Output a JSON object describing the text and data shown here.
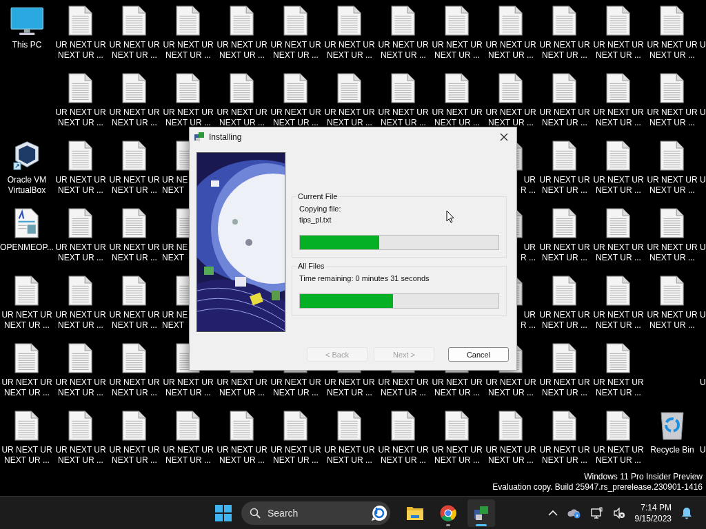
{
  "desktop": {
    "rows": [
      [
        {
          "kind": "computer",
          "label_lines": [
            "This PC"
          ]
        },
        {
          "kind": "text_file",
          "label_lines": [
            "UR NEXT UR",
            "NEXT UR ..."
          ]
        },
        {
          "kind": "text_file",
          "label_lines": [
            "UR NEXT UR",
            "NEXT UR ..."
          ]
        },
        {
          "kind": "text_file",
          "label_lines": [
            "UR NEXT UR",
            "NEXT UR ..."
          ]
        },
        {
          "kind": "text_file",
          "label_lines": [
            "UR NEXT UR",
            "NEXT UR ..."
          ]
        },
        {
          "kind": "text_file",
          "label_lines": [
            "UR NEXT UR",
            "NEXT UR ..."
          ]
        },
        {
          "kind": "text_file",
          "label_lines": [
            "UR NEXT UR",
            "NEXT UR ..."
          ]
        },
        {
          "kind": "text_file",
          "label_lines": [
            "UR NEXT UR",
            "NEXT UR ..."
          ]
        },
        {
          "kind": "text_file",
          "label_lines": [
            "UR NEXT UR",
            "NEXT UR ..."
          ]
        },
        {
          "kind": "text_file",
          "label_lines": [
            "UR NEXT UR",
            "NEXT UR ..."
          ]
        },
        {
          "kind": "text_file",
          "label_lines": [
            "UR NEXT UR",
            "NEXT UR ..."
          ]
        },
        {
          "kind": "text_file",
          "label_lines": [
            "UR NEXT UR",
            "NEXT UR ..."
          ]
        },
        {
          "kind": "text_file",
          "label_lines": [
            "UR NEXT UR",
            "NEXT UR ..."
          ]
        },
        {
          "kind": "label_only",
          "label_lines": [
            "U"
          ],
          "clipped_end": true
        }
      ],
      [
        {
          "kind": "empty"
        },
        {
          "kind": "text_file",
          "label_lines": [
            "UR NEXT UR",
            "NEXT UR ..."
          ]
        },
        {
          "kind": "text_file",
          "label_lines": [
            "UR NEXT UR",
            "NEXT UR ..."
          ]
        },
        {
          "kind": "text_file",
          "label_lines": [
            "UR NEXT UR",
            "NEXT UR ..."
          ]
        },
        {
          "kind": "text_file",
          "label_lines": [
            "UR NEXT UR",
            "NEXT UR ..."
          ]
        },
        {
          "kind": "text_file",
          "label_lines": [
            "UR NEXT UR",
            "NEXT UR ..."
          ]
        },
        {
          "kind": "text_file",
          "label_lines": [
            "UR NEXT UR",
            "NEXT UR ..."
          ]
        },
        {
          "kind": "text_file",
          "label_lines": [
            "UR NEXT UR",
            "NEXT UR ..."
          ]
        },
        {
          "kind": "text_file",
          "label_lines": [
            "UR NEXT UR",
            "NEXT UR ..."
          ]
        },
        {
          "kind": "text_file",
          "label_lines": [
            "UR NEXT UR",
            "NEXT UR ..."
          ]
        },
        {
          "kind": "text_file",
          "label_lines": [
            "UR NEXT UR",
            "NEXT UR ..."
          ]
        },
        {
          "kind": "text_file",
          "label_lines": [
            "UR NEXT UR",
            "NEXT UR ..."
          ]
        },
        {
          "kind": "text_file",
          "label_lines": [
            "UR NEXT UR",
            "NEXT UR ..."
          ]
        },
        {
          "kind": "label_only",
          "label_lines": [
            "U"
          ],
          "clipped_end": true
        }
      ],
      [
        {
          "kind": "virtual_machine",
          "label_lines": [
            "Oracle VM",
            "VirtualBox"
          ]
        },
        {
          "kind": "text_file",
          "label_lines": [
            "UR NEXT UR",
            "NEXT UR ..."
          ]
        },
        {
          "kind": "text_file",
          "label_lines": [
            "UR NEXT UR",
            "NEXT UR ..."
          ]
        },
        {
          "kind": "text_file",
          "label_lines": [
            "UR NE",
            "NEXT"
          ],
          "clipped_end": true
        },
        {
          "kind": "empty"
        },
        {
          "kind": "empty"
        },
        {
          "kind": "empty"
        },
        {
          "kind": "empty"
        },
        {
          "kind": "empty"
        },
        {
          "kind": "text_file",
          "label_lines": [
            "UR",
            "R ..."
          ],
          "clipped_start": true
        },
        {
          "kind": "text_file",
          "label_lines": [
            "UR NEXT UR",
            "NEXT UR ..."
          ]
        },
        {
          "kind": "text_file",
          "label_lines": [
            "UR NEXT UR",
            "NEXT UR ..."
          ]
        },
        {
          "kind": "text_file",
          "label_lines": [
            "UR NEXT UR",
            "NEXT UR ..."
          ]
        },
        {
          "kind": "label_only",
          "label_lines": [
            "U"
          ],
          "clipped_end": true
        }
      ],
      [
        {
          "kind": "document",
          "label_lines": [
            "OPENMEOP..."
          ]
        },
        {
          "kind": "text_file",
          "label_lines": [
            "UR NEXT UR",
            "NEXT UR ..."
          ]
        },
        {
          "kind": "text_file",
          "label_lines": [
            "UR NEXT UR",
            "NEXT UR ..."
          ]
        },
        {
          "kind": "text_file",
          "label_lines": [
            "UR NE",
            "NEXT"
          ],
          "clipped_end": true
        },
        {
          "kind": "empty"
        },
        {
          "kind": "empty"
        },
        {
          "kind": "empty"
        },
        {
          "kind": "empty"
        },
        {
          "kind": "empty"
        },
        {
          "kind": "text_file",
          "label_lines": [
            "UR",
            "R ..."
          ],
          "clipped_start": true
        },
        {
          "kind": "text_file",
          "label_lines": [
            "UR NEXT UR",
            "NEXT UR ..."
          ]
        },
        {
          "kind": "text_file",
          "label_lines": [
            "UR NEXT UR",
            "NEXT UR ..."
          ]
        },
        {
          "kind": "text_file",
          "label_lines": [
            "UR NEXT UR",
            "NEXT UR ..."
          ]
        },
        {
          "kind": "label_only",
          "label_lines": [
            "U"
          ],
          "clipped_end": true
        }
      ],
      [
        {
          "kind": "text_file",
          "label_lines": [
            "UR NEXT UR",
            "NEXT UR ..."
          ]
        },
        {
          "kind": "text_file",
          "label_lines": [
            "UR NEXT UR",
            "NEXT UR ..."
          ]
        },
        {
          "kind": "text_file",
          "label_lines": [
            "UR NEXT UR",
            "NEXT UR ..."
          ]
        },
        {
          "kind": "text_file",
          "label_lines": [
            "UR NE",
            "NEXT"
          ],
          "clipped_end": true
        },
        {
          "kind": "empty"
        },
        {
          "kind": "empty"
        },
        {
          "kind": "empty"
        },
        {
          "kind": "empty"
        },
        {
          "kind": "empty"
        },
        {
          "kind": "text_file",
          "label_lines": [
            "UR",
            "R ..."
          ],
          "clipped_start": true
        },
        {
          "kind": "text_file",
          "label_lines": [
            "UR NEXT UR",
            "NEXT UR ..."
          ]
        },
        {
          "kind": "text_file",
          "label_lines": [
            "UR NEXT UR",
            "NEXT UR ..."
          ]
        },
        {
          "kind": "text_file",
          "label_lines": [
            "UR NEXT UR",
            "NEXT UR ..."
          ]
        },
        {
          "kind": "label_only",
          "label_lines": [
            "U"
          ],
          "clipped_end": true
        }
      ],
      [
        {
          "kind": "text_file",
          "label_lines": [
            "UR NEXT UR",
            "NEXT UR ..."
          ]
        },
        {
          "kind": "text_file",
          "label_lines": [
            "UR NEXT UR",
            "NEXT UR ..."
          ]
        },
        {
          "kind": "text_file",
          "label_lines": [
            "UR NEXT UR",
            "NEXT UR ..."
          ]
        },
        {
          "kind": "text_file",
          "label_lines": [
            "UR NEXT UR",
            "NEXT UR ..."
          ]
        },
        {
          "kind": "text_file",
          "label_lines": [
            "UR NEXT UR",
            "NEXT UR ..."
          ]
        },
        {
          "kind": "text_file",
          "label_lines": [
            "UR NEXT UR",
            "NEXT UR ..."
          ]
        },
        {
          "kind": "text_file",
          "label_lines": [
            "UR NEXT UR",
            "NEXT UR ..."
          ]
        },
        {
          "kind": "text_file",
          "label_lines": [
            "UR NEXT UR",
            "NEXT UR ..."
          ]
        },
        {
          "kind": "text_file",
          "label_lines": [
            "UR NEXT UR",
            "NEXT UR ..."
          ]
        },
        {
          "kind": "text_file",
          "label_lines": [
            "UR NEXT UR",
            "NEXT UR ..."
          ]
        },
        {
          "kind": "text_file",
          "label_lines": [
            "UR NEXT UR",
            "NEXT UR ..."
          ]
        },
        {
          "kind": "text_file",
          "label_lines": [
            "UR NEXT UR",
            "NEXT UR ..."
          ]
        },
        {
          "kind": "empty"
        },
        {
          "kind": "label_only",
          "label_lines": [
            "U"
          ],
          "clipped_end": true
        }
      ],
      [
        {
          "kind": "text_file",
          "label_lines": [
            "UR NEXT UR",
            "NEXT UR ..."
          ]
        },
        {
          "kind": "text_file",
          "label_lines": [
            "UR NEXT UR",
            "NEXT UR ..."
          ]
        },
        {
          "kind": "text_file",
          "label_lines": [
            "UR NEXT UR",
            "NEXT UR ..."
          ]
        },
        {
          "kind": "text_file",
          "label_lines": [
            "UR NEXT UR",
            "NEXT UR ..."
          ]
        },
        {
          "kind": "text_file",
          "label_lines": [
            "UR NEXT UR",
            "NEXT UR ..."
          ]
        },
        {
          "kind": "text_file",
          "label_lines": [
            "UR NEXT UR",
            "NEXT UR ..."
          ]
        },
        {
          "kind": "text_file",
          "label_lines": [
            "UR NEXT UR",
            "NEXT UR ..."
          ]
        },
        {
          "kind": "text_file",
          "label_lines": [
            "UR NEXT UR",
            "NEXT UR ..."
          ]
        },
        {
          "kind": "text_file",
          "label_lines": [
            "UR NEXT UR",
            "NEXT UR ..."
          ]
        },
        {
          "kind": "text_file",
          "label_lines": [
            "UR NEXT UR",
            "NEXT UR ..."
          ]
        },
        {
          "kind": "text_file",
          "label_lines": [
            "UR NEXT UR",
            "NEXT UR ..."
          ]
        },
        {
          "kind": "text_file",
          "label_lines": [
            "UR NEXT UR",
            "NEXT UR ..."
          ]
        },
        {
          "kind": "recycle_bin",
          "label_lines": [
            "Recycle Bin"
          ]
        },
        {
          "kind": "label_only",
          "label_lines": [
            "U"
          ],
          "clipped_end": true
        }
      ]
    ],
    "watermark": [
      "Windows 11 Pro Insider Preview",
      "Evaluation copy. Build 25947.rs_prerelease.230901-1416"
    ]
  },
  "dialog": {
    "title": "Installing",
    "groups": [
      {
        "title": "Current File",
        "lines": [
          "Copying file:",
          "tips_pl.txt"
        ],
        "level": 0.4
      },
      {
        "title": "All Files",
        "lines": [
          "Time remaining: 0 minutes 31 seconds"
        ],
        "level": 0.47
      }
    ],
    "buttons": [
      {
        "label": "< Back",
        "disabled": true,
        "default": false
      },
      {
        "label": "Next >",
        "disabled": true,
        "default": false
      },
      {
        "label": "Cancel",
        "disabled": false,
        "default": true
      }
    ]
  },
  "taskbar": {
    "search": {
      "placeholder": "Search"
    },
    "apps": [
      {
        "kind": "folder",
        "running": false,
        "active": false
      },
      {
        "kind": "browser",
        "running": true,
        "active": false
      },
      {
        "kind": "installer",
        "running": true,
        "active": true
      }
    ],
    "time": "7:14 PM",
    "date": "9/15/2023"
  }
}
